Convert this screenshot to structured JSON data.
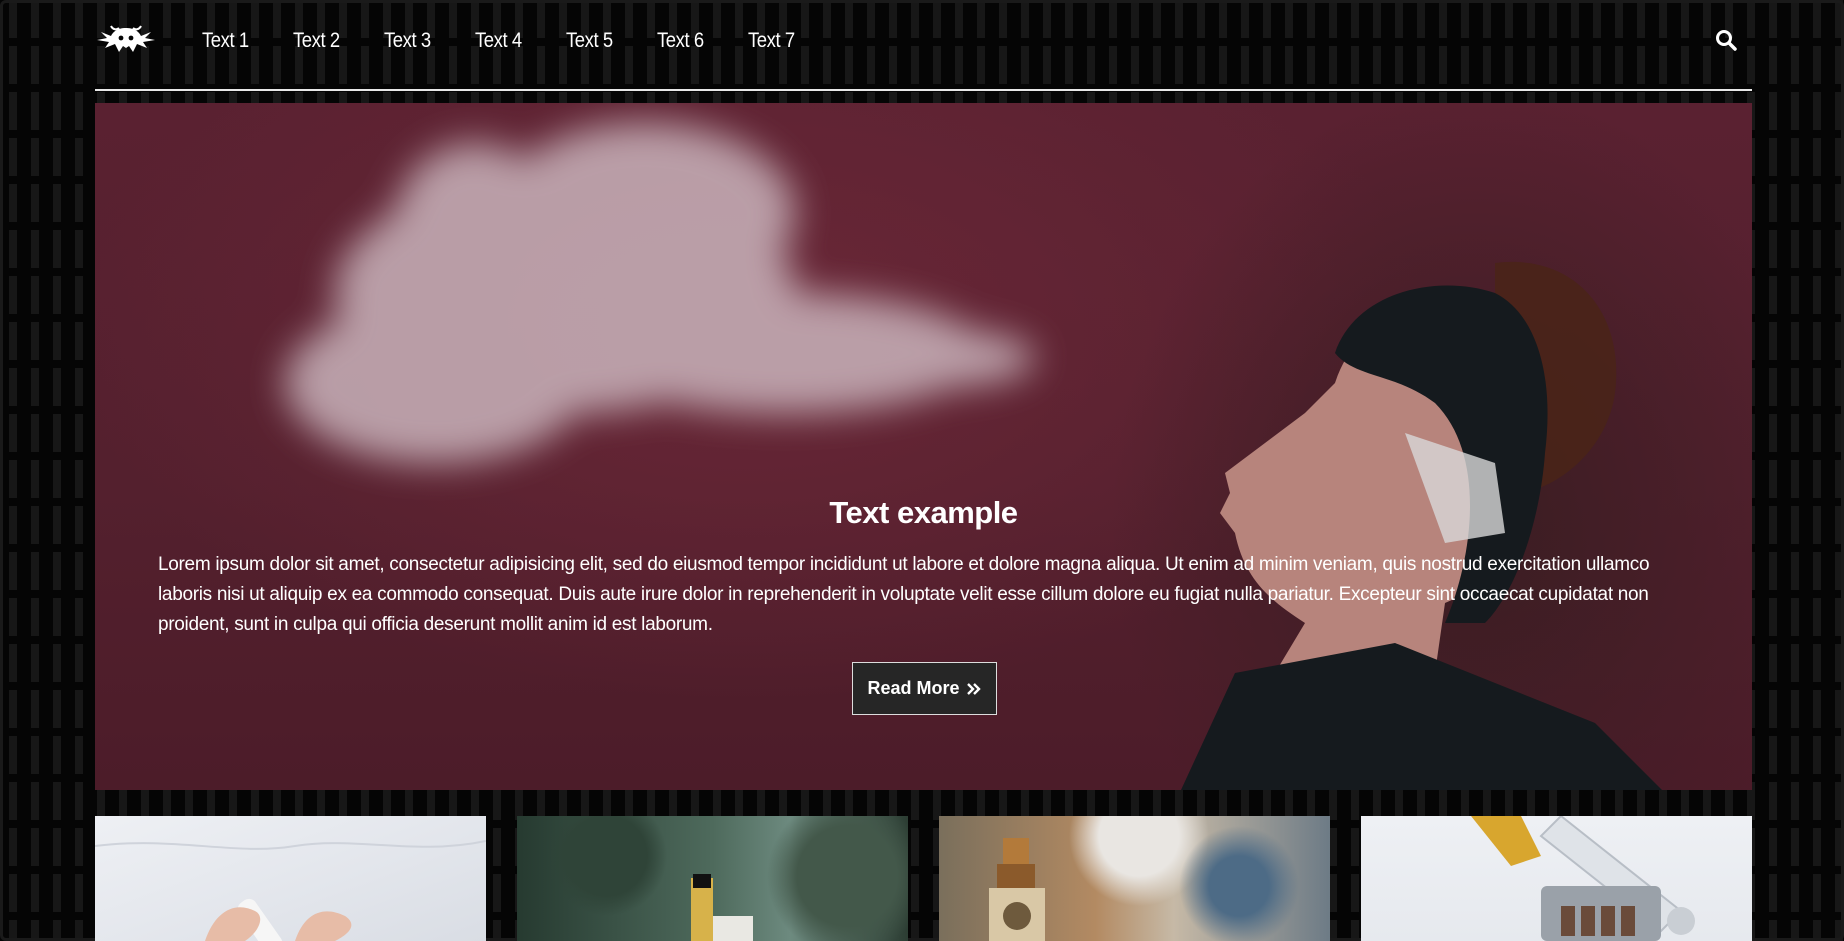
{
  "nav": {
    "logo": "bull-skull-logo",
    "items": [
      "Text 1",
      "Text 2",
      "Text 3",
      "Text 4",
      "Text 5",
      "Text 6",
      "Text 7"
    ],
    "search_icon": "search-icon"
  },
  "hero": {
    "title": "Text example",
    "body": "Lorem ipsum dolor sit amet, consectetur adipisicing elit, sed do eiusmod tempor incididunt ut labore et dolore magna aliqua. Ut enim ad minim veniam, quis nostrud exercitation ullamco laboris nisi ut aliquip ex ea commodo consequat. Duis aute irure dolor in reprehenderit in voluptate velit esse cillum dolore eu fugiat nulla pariatur. Excepteur sint occaecat cupidatat non proident, sunt in culpa qui officia deserunt mollit anim id est laborum.",
    "button_label": "Read More",
    "button_icon": "double-chevron-right-icon"
  },
  "cards": [
    "hands-with-device-image",
    "vape-pen-on-box-image",
    "rda-atomizer-image",
    "coil-build-dripping-image"
  ],
  "colors": {
    "background": "#050505",
    "hero": "#5a2131",
    "button": "#262626",
    "text": "#ffffff"
  }
}
